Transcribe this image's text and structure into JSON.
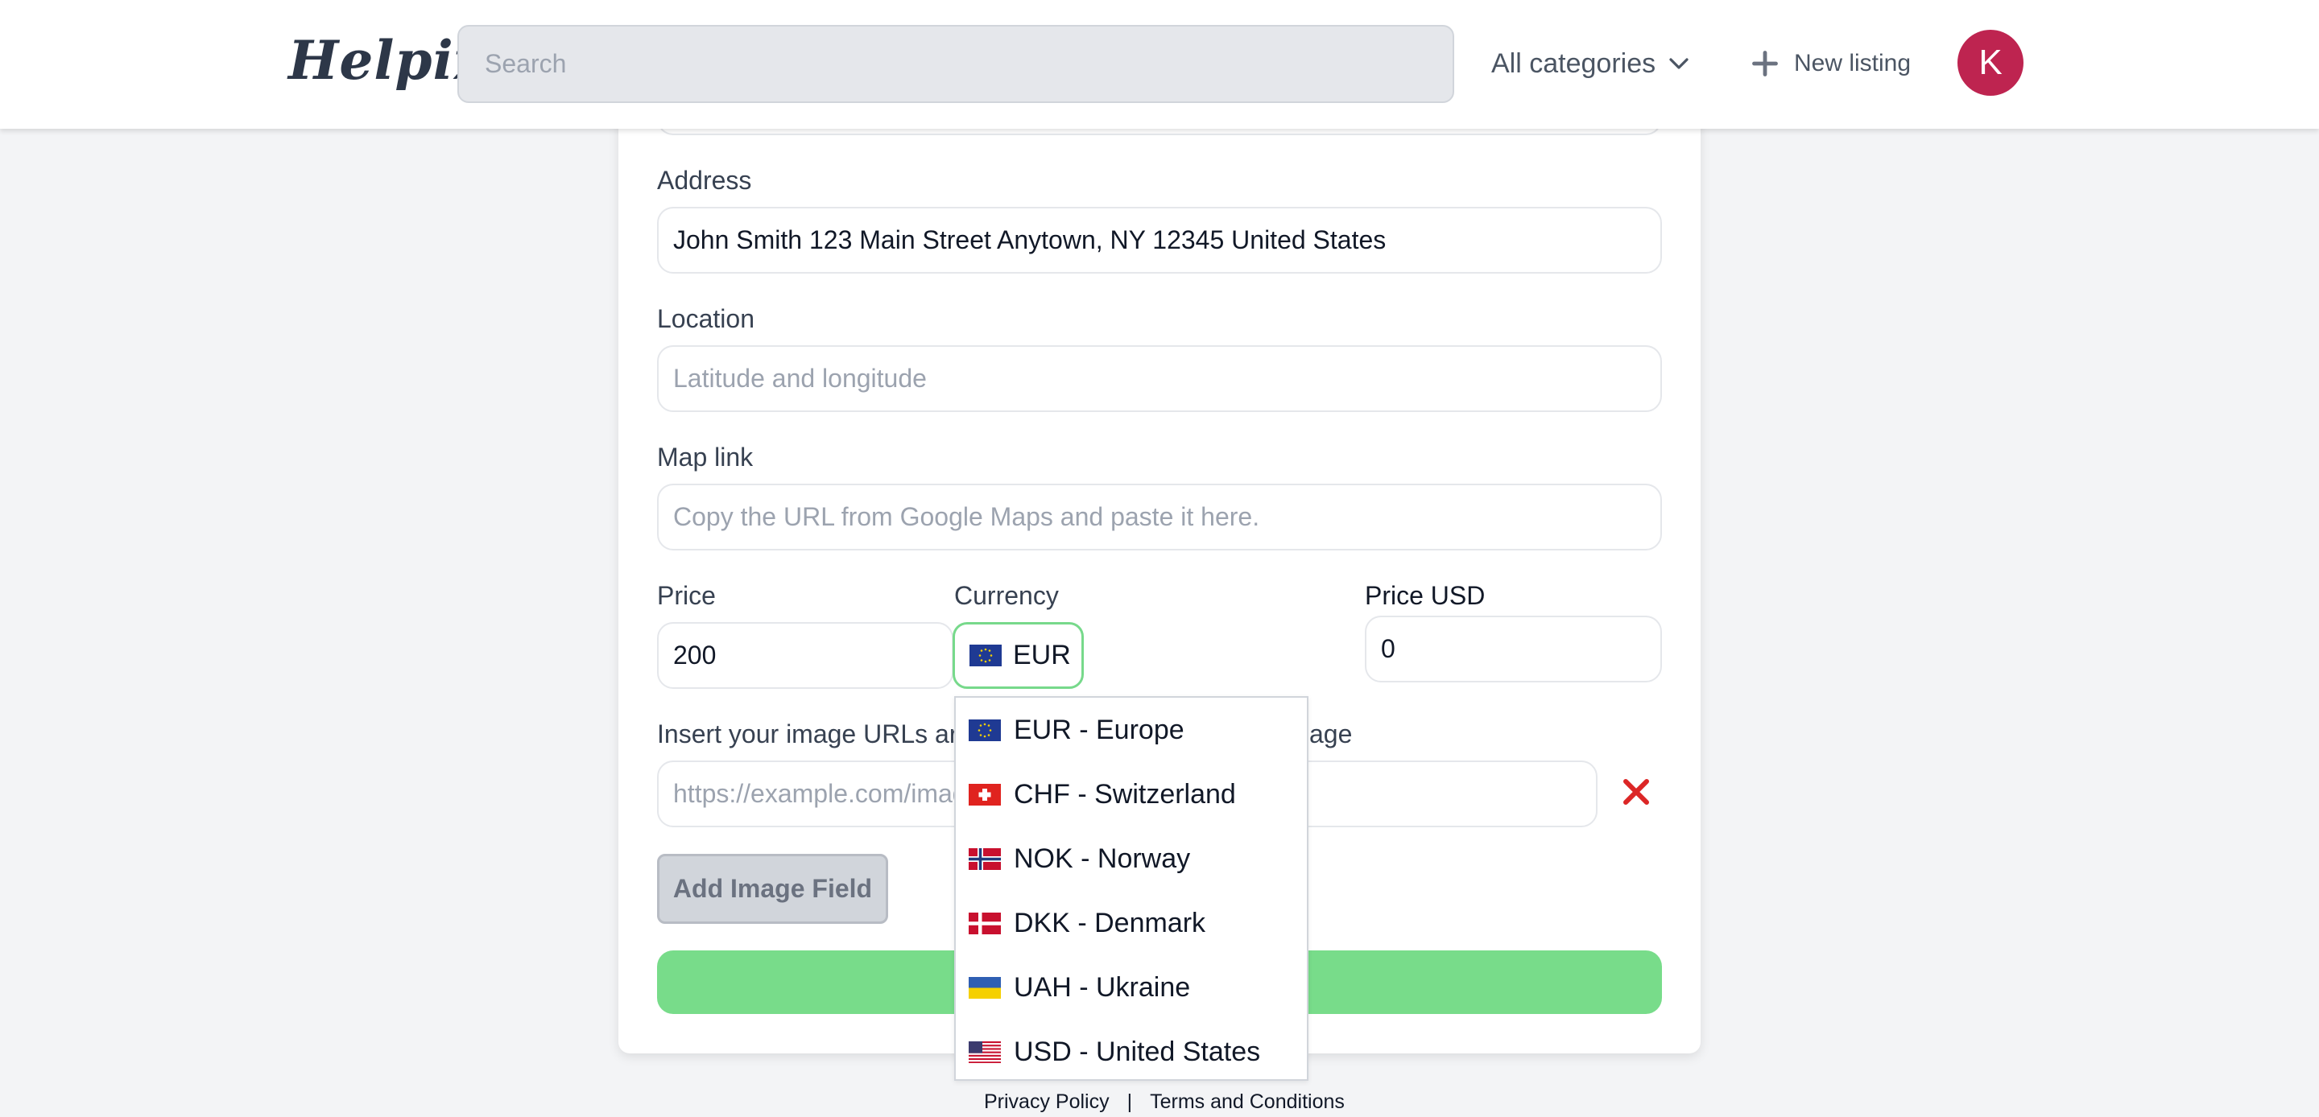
{
  "header": {
    "logo": "Helpix",
    "search_placeholder": "Search",
    "categories_label": "All categories",
    "new_listing_label": "New listing",
    "avatar_initial": "K",
    "avatar_color": "#be2450"
  },
  "form": {
    "address": {
      "label": "Address",
      "value": "John Smith 123 Main Street Anytown, NY 12345 United States"
    },
    "location": {
      "label": "Location",
      "placeholder": "Latitude and longitude"
    },
    "map_link": {
      "label": "Map link",
      "placeholder": "Copy the URL from Google Maps and paste it here."
    },
    "price": {
      "label": "Price",
      "value": "200"
    },
    "currency": {
      "label": "Currency",
      "selected": "EUR"
    },
    "price_usd": {
      "label": "Price USD",
      "value": "0"
    },
    "image_urls": {
      "label_left": "Insert your image URLs ar",
      "label_right": "age",
      "placeholder": "https://example.com/imag"
    },
    "add_image_button": "Add Image Field",
    "submit_color": "#78dc8a"
  },
  "currency_dropdown": {
    "options": [
      {
        "label": "EUR - Europe",
        "flag": "eu-flag-icon"
      },
      {
        "label": "CHF - Switzerland",
        "flag": "switzerland-flag-icon"
      },
      {
        "label": "NOK - Norway",
        "flag": "norway-flag-icon"
      },
      {
        "label": "DKK - Denmark",
        "flag": "denmark-flag-icon"
      },
      {
        "label": "UAH - Ukraine",
        "flag": "ukraine-flag-icon"
      },
      {
        "label": "USD - United States",
        "flag": "usa-flag-icon"
      }
    ]
  },
  "footer": {
    "privacy": "Privacy Policy",
    "separator": "|",
    "terms": "Terms and Conditions"
  },
  "colors": {
    "accent_green": "#77d98b",
    "remove_red": "#dc2626"
  }
}
